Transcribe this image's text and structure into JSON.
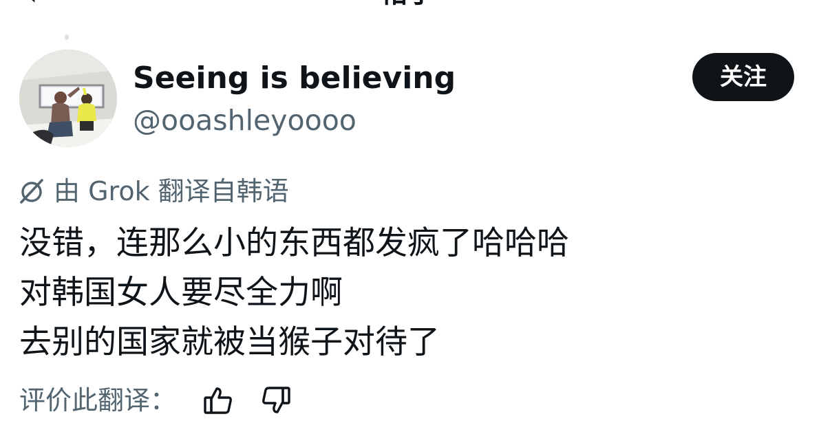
{
  "header": {
    "title_fragment": "帖子",
    "back_glyph": "‹"
  },
  "author": {
    "display_name": "Seeing is believing",
    "handle": "@ooashleyoooo",
    "avatar_icon": "avatar-photo"
  },
  "follow": {
    "label": "关注"
  },
  "translation": {
    "label": "由 Grok 翻译自韩语",
    "icon": "grok-icon"
  },
  "tweet": {
    "lines": [
      "没错，连那么小的东西都发疯了哈哈哈",
      "对韩国女人要尽全力啊",
      "去别的国家就被当猴子对待了"
    ]
  },
  "rating": {
    "label": "评价此翻译：",
    "up_icon": "thumbs-up-icon",
    "down_icon": "thumbs-down-icon"
  },
  "colors": {
    "text_primary": "#0f1419",
    "text_secondary": "#536471",
    "button_bg": "#0f1419",
    "button_text": "#ffffff"
  }
}
